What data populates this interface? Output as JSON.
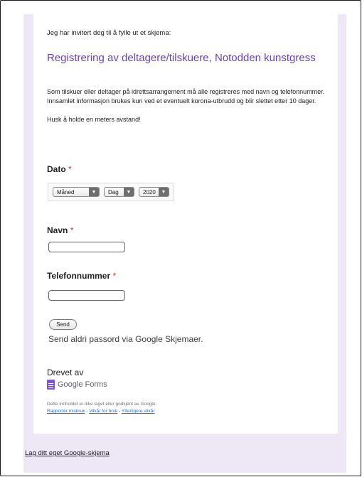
{
  "form": {
    "invite_text": "Jeg har invitert deg til å fylle ut et skjema:",
    "title": "Registrering av deltagere/tilskuere, Notodden kunstgress",
    "description_p1": "Som tilskuer eller deltager på idrettsarrangement må alle registreres med navn og telefonnummer. Innsamlet informasjon brukes kun ved et eventuelt korona-utbrudd og blir slettet etter 10 dager.",
    "description_p2": "Husk å holde en meters avstand!",
    "required_marker": "*"
  },
  "questions": {
    "date": {
      "label": "Dato",
      "month_value": "Måned",
      "day_value": "Dag",
      "year_value": "2020"
    },
    "name": {
      "label": "Navn",
      "value": ""
    },
    "phone": {
      "label": "Telefonnummer",
      "value": ""
    }
  },
  "actions": {
    "send_label": "Send",
    "password_warning": "Send aldri passord via Google Skjemaer."
  },
  "branding": {
    "powered_by": "Drevet av",
    "product_name": "Google Forms",
    "icon": "google-forms-icon",
    "color": "#7e57c2"
  },
  "legal": {
    "disclaimer": "Dette innholdet er ikke laget eller godkjent av Google.",
    "report_abuse": "Rapportér misbruk",
    "terms": "Vilkår for bruk",
    "additional_terms": "Ytterligere vilkår",
    "separator": " - "
  },
  "footer": {
    "create_own": "Lag ditt eget Google-skjema"
  },
  "colors": {
    "accent": "#6a3fb6",
    "page_background": "#ede7f6",
    "required": "#d93025",
    "link": "#1a73e8"
  }
}
